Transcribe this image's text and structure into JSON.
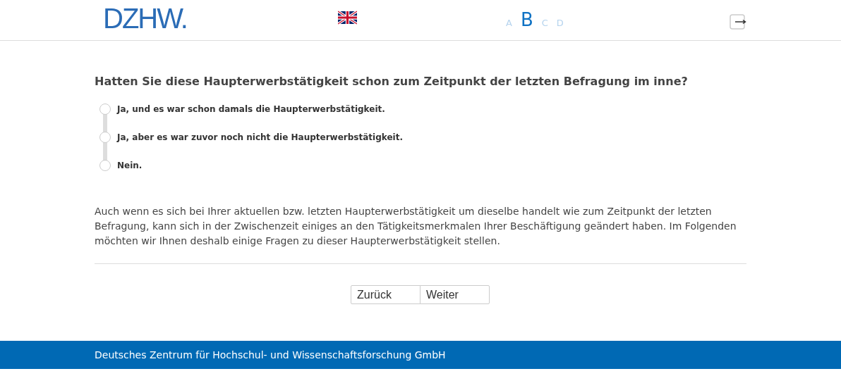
{
  "header": {
    "logo": "DZHW.",
    "steps": [
      {
        "label": "A",
        "selected": false
      },
      {
        "label": "B",
        "selected": true
      },
      {
        "label": "C",
        "selected": false
      },
      {
        "label": "D",
        "selected": false
      }
    ]
  },
  "question": "Hatten Sie diese Haupterwerbstätigkeit schon zum Zeitpunkt der letzten Befragung im inne?",
  "options": [
    {
      "label": "Ja, und es war schon damals die Haupterwerbstätigkeit.",
      "selected": false
    },
    {
      "label": "Ja, aber es war zuvor noch nicht die Haupterwerbstätigkeit.",
      "selected": false
    },
    {
      "label": "Nein.",
      "selected": false
    }
  ],
  "info": "Auch wenn es sich bei Ihrer aktuellen bzw. letzten Haupterwerbstätigkeit um dieselbe handelt wie zum Zeitpunkt der letzten Befragung, kann sich in der Zwischenzeit einiges an den Tätigkeitsmerkmalen Ihrer Beschäftigung geändert haben. Im Folgenden möchten wir Ihnen deshalb einige Fragen zu dieser Haupterwerbstätigkeit stellen.",
  "buttons": [
    "Zurück",
    "Weiter"
  ],
  "footer": "Deutsches Zentrum für Hochschul- und Wissenschaftsforschung GmbH"
}
